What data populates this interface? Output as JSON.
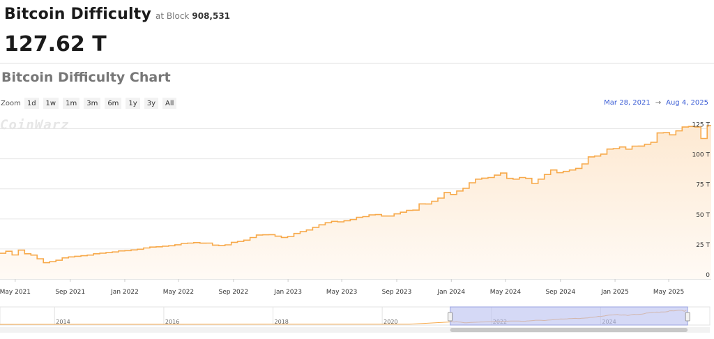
{
  "header": {
    "title": "Bitcoin Difficulty",
    "at_block_label": "at Block",
    "block_number": "908,531",
    "current_difficulty": "127.62 T"
  },
  "chart_section": {
    "title": "Bitcoin Difficulty Chart",
    "zoom_label": "Zoom",
    "zoom_buttons": [
      "1d",
      "1w",
      "1m",
      "3m",
      "6m",
      "1y",
      "3y",
      "All"
    ],
    "range_start": "Mar 28, 2021",
    "range_arrow": "→",
    "range_end": "Aug 4, 2025",
    "watermark": "CoinWarz"
  },
  "colors": {
    "line": "#f7a94a",
    "area_top": "#fde9d2",
    "area_bottom": "#fffaf5",
    "grid": "#e6e6e6",
    "axis_text": "#333333",
    "range_text": "#3d5fd6",
    "navigator_mask": "#b9c0f0"
  },
  "chart_data": {
    "type": "area",
    "title": "Bitcoin Difficulty Chart",
    "xlabel": "",
    "ylabel": "",
    "x_range": [
      "2021-03-28",
      "2025-08-04"
    ],
    "ylim": [
      0,
      137.5
    ],
    "y_ticks": [
      0,
      25,
      50,
      75,
      100,
      125
    ],
    "y_tick_labels": [
      "0",
      "25 T",
      "50 T",
      "75 T",
      "100 T",
      "125 T"
    ],
    "y_unit": "T",
    "x_tick_labels": [
      {
        "date": "2021-05-01",
        "label": "May 2021"
      },
      {
        "date": "2021-09-01",
        "label": "Sep 2021"
      },
      {
        "date": "2022-01-01",
        "label": "Jan 2022"
      },
      {
        "date": "2022-05-01",
        "label": "May 2022"
      },
      {
        "date": "2022-09-01",
        "label": "Sep 2022"
      },
      {
        "date": "2023-01-01",
        "label": "Jan 2023"
      },
      {
        "date": "2023-05-01",
        "label": "May 2023"
      },
      {
        "date": "2023-09-01",
        "label": "Sep 2023"
      },
      {
        "date": "2024-01-01",
        "label": "Jan 2024"
      },
      {
        "date": "2024-05-01",
        "label": "May 2024"
      },
      {
        "date": "2024-09-01",
        "label": "Sep 2024"
      },
      {
        "date": "2025-01-01",
        "label": "Jan 2025"
      },
      {
        "date": "2025-05-01",
        "label": "May 2025"
      }
    ],
    "grid": true,
    "legend": "none",
    "step": true,
    "series": [
      {
        "dates": [
          "2021-03-28",
          "2021-04-10",
          "2021-04-24",
          "2021-05-08",
          "2021-05-22",
          "2021-06-05",
          "2021-06-19",
          "2021-07-03",
          "2021-07-17",
          "2021-07-31",
          "2021-08-14",
          "2021-08-28",
          "2021-09-11",
          "2021-09-25",
          "2021-10-09",
          "2021-10-23",
          "2021-11-06",
          "2021-11-20",
          "2021-12-04",
          "2021-12-18",
          "2022-01-01",
          "2022-01-15",
          "2022-01-29",
          "2022-02-12",
          "2022-02-26",
          "2022-03-12",
          "2022-03-26",
          "2022-04-09",
          "2022-04-23",
          "2022-05-07",
          "2022-05-21",
          "2022-06-04",
          "2022-06-18",
          "2022-07-02",
          "2022-07-16",
          "2022-07-30",
          "2022-08-13",
          "2022-08-27",
          "2022-09-10",
          "2022-09-24",
          "2022-10-08",
          "2022-10-22",
          "2022-11-05",
          "2022-11-19",
          "2022-12-03",
          "2022-12-17",
          "2022-12-31",
          "2023-01-14",
          "2023-01-28",
          "2023-02-11",
          "2023-02-25",
          "2023-03-11",
          "2023-03-25",
          "2023-04-08",
          "2023-04-22",
          "2023-05-06",
          "2023-05-20",
          "2023-06-03",
          "2023-06-17",
          "2023-07-01",
          "2023-07-15",
          "2023-07-29",
          "2023-08-12",
          "2023-08-26",
          "2023-09-09",
          "2023-09-23",
          "2023-10-07",
          "2023-10-21",
          "2023-11-04",
          "2023-11-18",
          "2023-12-02",
          "2023-12-16",
          "2023-12-30",
          "2024-01-13",
          "2024-01-27",
          "2024-02-10",
          "2024-02-24",
          "2024-03-09",
          "2024-03-23",
          "2024-04-06",
          "2024-04-20",
          "2024-05-04",
          "2024-05-18",
          "2024-06-01",
          "2024-06-15",
          "2024-06-29",
          "2024-07-13",
          "2024-07-27",
          "2024-08-10",
          "2024-08-24",
          "2024-09-07",
          "2024-09-21",
          "2024-10-05",
          "2024-10-19",
          "2024-11-02",
          "2024-11-16",
          "2024-11-30",
          "2024-12-14",
          "2024-12-28",
          "2025-01-11",
          "2025-01-25",
          "2025-02-08",
          "2025-02-22",
          "2025-03-08",
          "2025-03-22",
          "2025-04-05",
          "2025-04-19",
          "2025-05-03",
          "2025-05-17",
          "2025-05-31",
          "2025-06-14",
          "2025-06-28",
          "2025-07-12",
          "2025-07-26"
        ],
        "values": [
          21.4,
          23.1,
          20.0,
          24.0,
          21.0,
          19.9,
          16.8,
          13.6,
          14.4,
          15.6,
          17.6,
          18.4,
          18.9,
          19.4,
          19.9,
          21.0,
          21.5,
          22.0,
          22.5,
          23.4,
          23.6,
          24.2,
          24.8,
          25.8,
          26.6,
          26.8,
          27.3,
          27.7,
          28.5,
          29.6,
          29.9,
          30.3,
          29.8,
          29.9,
          28.2,
          27.8,
          28.4,
          30.5,
          31.3,
          32.3,
          34.5,
          36.6,
          36.8,
          36.9,
          35.6,
          34.6,
          35.4,
          37.9,
          39.4,
          40.8,
          43.0,
          45.1,
          46.8,
          48.0,
          47.5,
          48.5,
          49.5,
          51.3,
          51.9,
          53.3,
          53.6,
          52.4,
          52.4,
          54.2,
          55.6,
          57.1,
          57.3,
          62.5,
          62.4,
          64.7,
          67.3,
          72.0,
          70.3,
          73.2,
          75.5,
          80.0,
          83.1,
          83.9,
          84.4,
          86.4,
          88.1,
          83.7,
          83.1,
          84.4,
          83.7,
          79.5,
          83.1,
          86.9,
          90.7,
          88.4,
          89.5,
          90.7,
          92.0,
          95.7,
          101.6,
          102.3,
          103.9,
          108.1,
          108.5,
          109.8,
          108.0,
          110.5,
          110.6,
          112.1,
          113.8,
          121.5,
          121.7,
          119.9,
          123.2,
          126.4,
          126.9,
          126.4,
          116.9,
          127.6
        ]
      }
    ],
    "navigator": {
      "year_labels": [
        "2014",
        "2016",
        "2018",
        "2020",
        "2022",
        "2024"
      ],
      "selected_range": [
        "2021-03-28",
        "2025-08-04"
      ]
    }
  }
}
